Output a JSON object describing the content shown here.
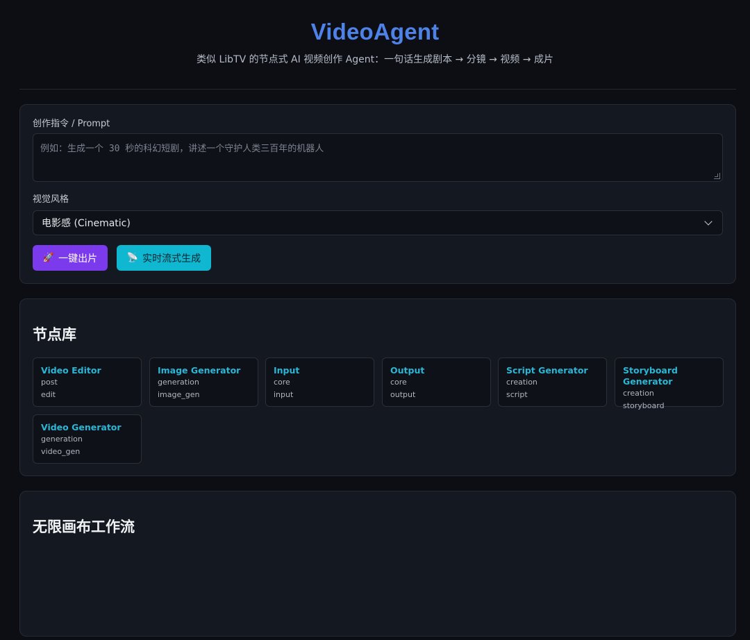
{
  "header": {
    "title": "VideoAgent",
    "subtitle": "类似 LibTV 的节点式 AI 视频创作 Agent：一句话生成剧本 → 分镜 → 视频 → 成片"
  },
  "form": {
    "prompt_label": "创作指令 / Prompt",
    "prompt_placeholder": "例如：生成一个 30 秒的科幻短剧，讲述一个守护人类三百年的机器人",
    "style_label": "视觉风格",
    "style_selected": "电影感 (Cinematic)",
    "btn_generate_emoji": "🚀",
    "btn_generate_label": "一键出片",
    "btn_stream_emoji": "📡",
    "btn_stream_label": "实时流式生成"
  },
  "nodes": {
    "title": "节点库",
    "items": [
      {
        "name": "Video Editor",
        "category": "post",
        "type": "edit"
      },
      {
        "name": "Image Generator",
        "category": "generation",
        "type": "image_gen"
      },
      {
        "name": "Input",
        "category": "core",
        "type": "input"
      },
      {
        "name": "Output",
        "category": "core",
        "type": "output"
      },
      {
        "name": "Script Generator",
        "category": "creation",
        "type": "script"
      },
      {
        "name": "Storyboard Generator",
        "category": "creation",
        "type": "storyboard"
      },
      {
        "name": "Video Generator",
        "category": "generation",
        "type": "video_gen"
      }
    ]
  },
  "canvas": {
    "title": "无限画布工作流"
  },
  "colors": {
    "title": "#4f82e6",
    "primary_button": "#7c3aed",
    "stream_button": "#0fb8d0",
    "node_name": "#2bb6d6"
  }
}
